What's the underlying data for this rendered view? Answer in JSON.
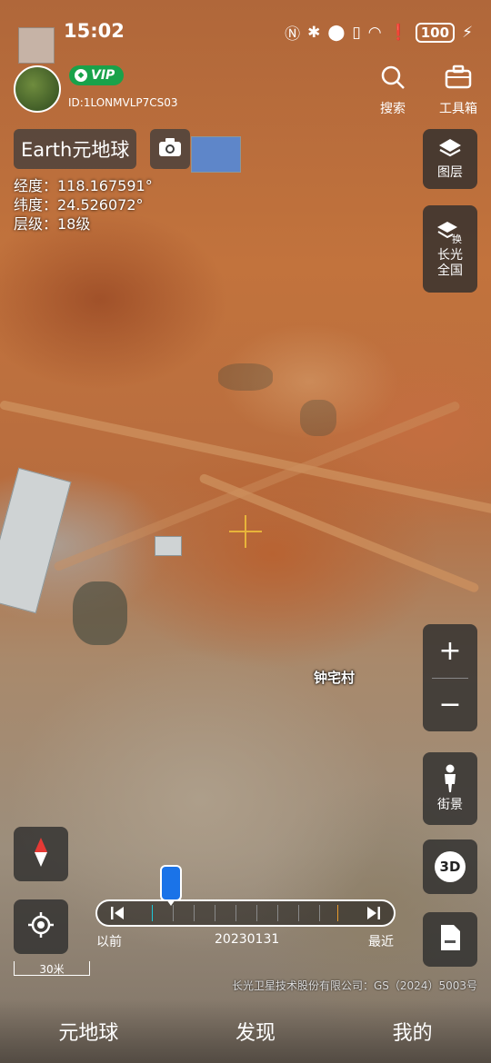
{
  "status_bar": {
    "time": "15:02",
    "battery": "100"
  },
  "user": {
    "vip_label": "VIP",
    "id": "ID:1LONMVLP7CS03"
  },
  "top_right": {
    "search_label": "搜索",
    "toolbox_label": "工具箱"
  },
  "title": "Earth元地球",
  "coords": {
    "longitude": "经度：118.167591°",
    "latitude": "纬度：24.526072°",
    "zoom": "层级：18级"
  },
  "side_buttons": {
    "layers_label": "图层",
    "source_line1": "长光",
    "source_line2": "全国",
    "streetview_label": "街景",
    "three_d_label": "3D"
  },
  "map": {
    "place_name": "钟宅村"
  },
  "timeline": {
    "prev_label": "以前",
    "date": "20230131",
    "latest_label": "最近"
  },
  "scale": "30米",
  "copyright": "长光卫星技术股份有限公司：GS（2024）5003号",
  "bottom_nav": {
    "tab1": "元地球",
    "tab2": "发现",
    "tab3": "我的"
  },
  "colors": {
    "vip_green": "#19a24a",
    "crosshair": "#e8b43a",
    "thumb_blue": "#1a73e8"
  }
}
